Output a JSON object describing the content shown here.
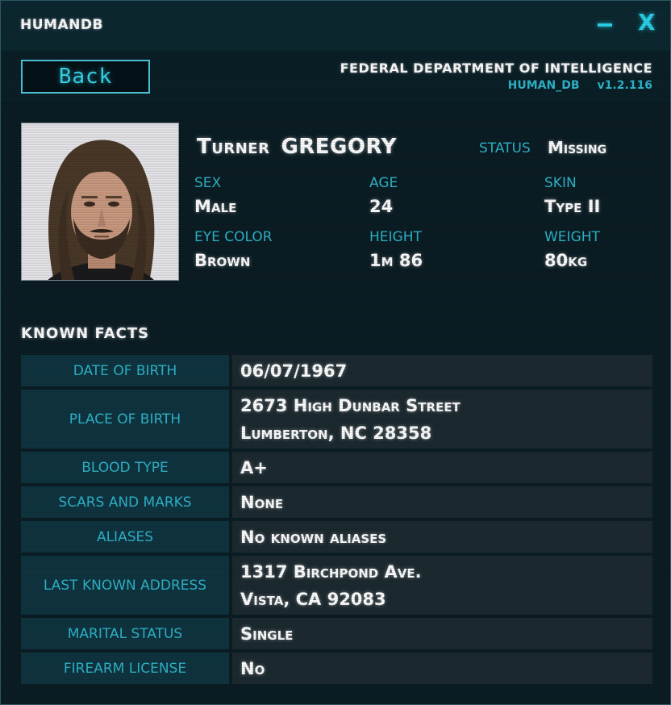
{
  "titlebar": {
    "app_name": "HUMANDB",
    "minimize_label": "minimize",
    "close_label": "X"
  },
  "header": {
    "back_label": "Back",
    "agency_name": "FEDERAL DEPARTMENT OF INTELLIGENCE",
    "db_name": "HUMAN_DB",
    "version": "v1.2.116"
  },
  "profile": {
    "first_name": "Turner",
    "last_name": "GREGORY",
    "status_label": "STATUS",
    "status_value": "Missing",
    "attributes": [
      {
        "label": "SEX",
        "value": "Male"
      },
      {
        "label": "AGE",
        "value": "24"
      },
      {
        "label": "SKIN",
        "value": "Type II"
      },
      {
        "label": "EYE COLOR",
        "value": "Brown"
      },
      {
        "label": "HEIGHT",
        "value": "1m 86"
      },
      {
        "label": "WEIGHT",
        "value": "80kg"
      }
    ]
  },
  "facts": {
    "title": "KNOWN FACTS",
    "rows": [
      {
        "label": "DATE OF BIRTH",
        "line1": "06/07/1967",
        "line2": ""
      },
      {
        "label": "PLACE OF BIRTH",
        "line1": "2673 High Dunbar Street",
        "line2": "Lumberton, NC 28358"
      },
      {
        "label": "BLOOD TYPE",
        "line1": "A+",
        "line2": ""
      },
      {
        "label": "SCARS AND MARKS",
        "line1": "None",
        "line2": ""
      },
      {
        "label": "ALIASES",
        "line1": "No known aliases",
        "line2": ""
      },
      {
        "label": "LAST KNOWN ADDRESS",
        "line1": "1317 Birchpond Ave.",
        "line2": "Vista, CA 92083"
      },
      {
        "label": "MARITAL STATUS",
        "line1": "Single",
        "line2": ""
      },
      {
        "label": "FIREARM LICENSE",
        "line1": "No",
        "line2": ""
      }
    ]
  },
  "colors": {
    "accent": "#2ad3ea",
    "label": "#2fb6cc",
    "background": "#0b1d24",
    "label_cell": "#0f3440",
    "value_cell": "#1c2a30"
  }
}
